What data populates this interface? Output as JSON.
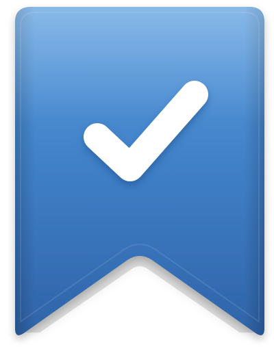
{
  "icon": {
    "name": "bookmark-check-icon",
    "glyph": "checkmark",
    "colors": {
      "ribbon_top": "#5a9ee0",
      "ribbon_mid": "#3f7fc6",
      "ribbon_bottom": "#2f63a8",
      "ribbon_edge_dark": "#285a98",
      "check_fill": "#ffffff",
      "check_shadow": "#1f4f8f",
      "background": "#ffffff"
    }
  }
}
